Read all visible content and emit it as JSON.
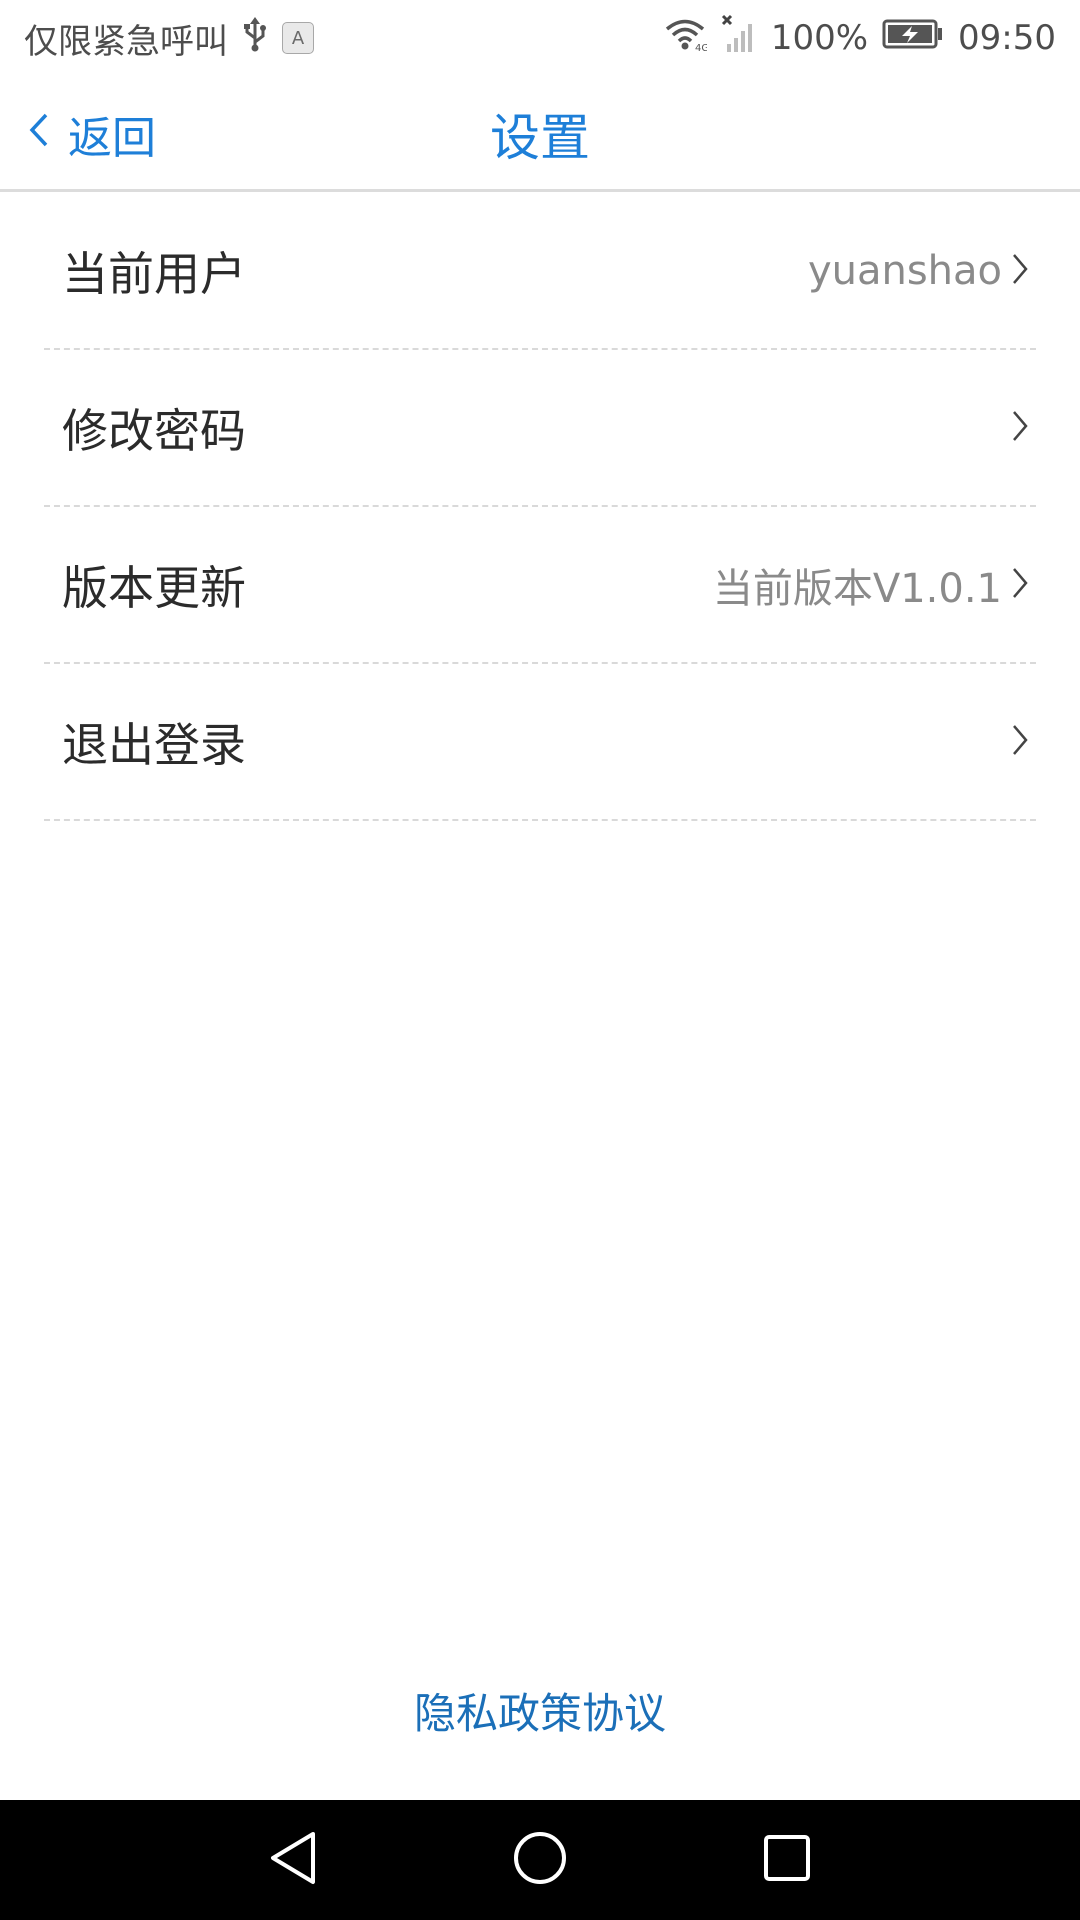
{
  "status_bar": {
    "carrier_text": "仅限紧急呼叫",
    "ime_badge": "A",
    "battery_percent": "100%",
    "time": "09:50",
    "icons": [
      "usb-icon",
      "ime-icon",
      "wifi-icon",
      "signal-icon",
      "battery-charging-icon"
    ]
  },
  "nav": {
    "back_label": "返回",
    "title": "设置"
  },
  "settings": {
    "items": [
      {
        "label": "当前用户",
        "value": "yuanshao"
      },
      {
        "label": "修改密码",
        "value": ""
      },
      {
        "label": "版本更新",
        "value": "当前版本V1.0.1"
      },
      {
        "label": "退出登录",
        "value": ""
      }
    ]
  },
  "footer": {
    "privacy_link": "隐私政策协议"
  },
  "system_nav": {
    "buttons": [
      "back-triangle-icon",
      "home-circle-icon",
      "recents-square-icon"
    ]
  },
  "colors": {
    "accent": "#1e7fd8",
    "link": "#1b6fb8",
    "text_primary": "#2b2b2b",
    "text_secondary": "#8a8a8a",
    "divider": "#d9d9d9",
    "nav_bar": "#000000"
  }
}
